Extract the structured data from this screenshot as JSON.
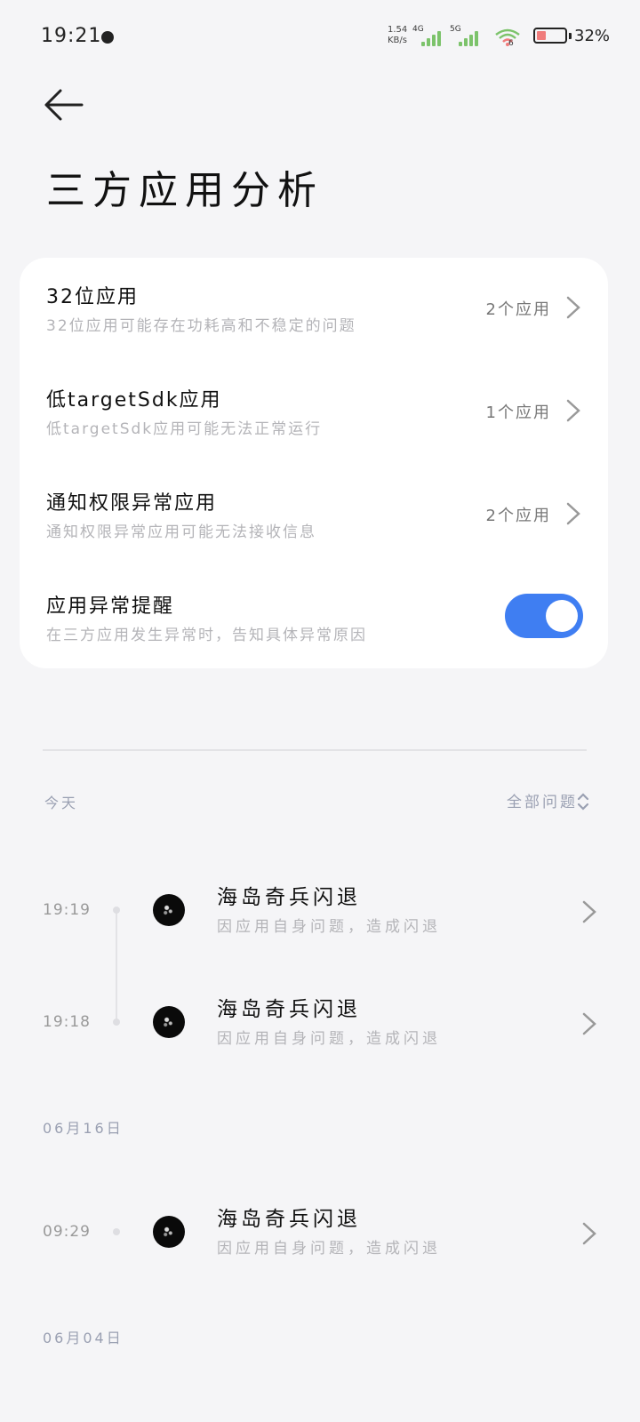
{
  "status_bar": {
    "time": "19:21",
    "net_speed_value": "1.54",
    "net_speed_unit": "KB/s",
    "sim1_label": "4G",
    "sim2_label": "5G",
    "wifi_label": "6",
    "battery_percent": 32,
    "battery_text": "32%",
    "battery_color": "#f07c7c"
  },
  "header": {
    "title": "三方应用分析"
  },
  "settings": [
    {
      "title": "32位应用",
      "subtitle": "32位应用可能存在功耗高和不稳定的问题",
      "value": "2个应用"
    },
    {
      "title": "低targetSdk应用",
      "subtitle": "低targetSdk应用可能无法正常运行",
      "value": "1个应用"
    },
    {
      "title": "通知权限异常应用",
      "subtitle": "通知权限异常应用可能无法接收信息",
      "value": "2个应用"
    },
    {
      "title": "应用异常提醒",
      "subtitle": "在三方应用发生异常时，告知具体异常原因",
      "toggle_on": true
    }
  ],
  "timeline": {
    "today_label": "今天",
    "filter_label": "全部问题",
    "date_labels": [
      "06月16日",
      "06月04日"
    ],
    "items": [
      {
        "time": "19:19",
        "title": "海岛奇兵闪退",
        "subtitle": "因应用自身问题，造成闪退"
      },
      {
        "time": "19:18",
        "title": "海岛奇兵闪退",
        "subtitle": "因应用自身问题，造成闪退"
      },
      {
        "time": "09:29",
        "title": "海岛奇兵闪退",
        "subtitle": "因应用自身问题，造成闪退"
      }
    ]
  },
  "colors": {
    "accent": "#3f7ef2",
    "background": "#f5f5f7",
    "card": "#ffffff",
    "secondary_text": "#b4b4b8",
    "section_label": "#9aa0b2"
  }
}
